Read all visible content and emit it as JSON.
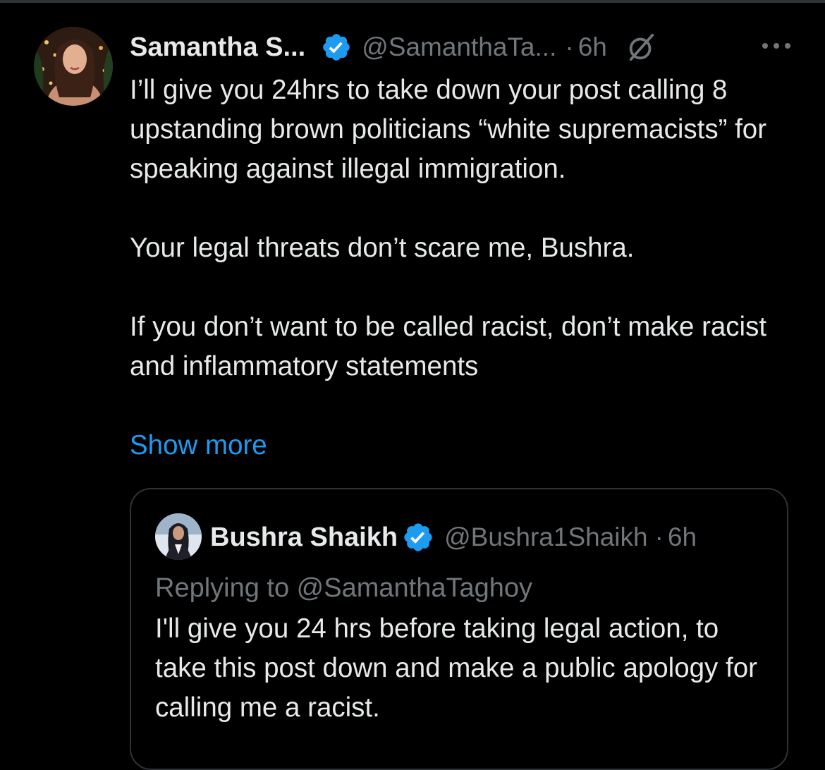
{
  "tweet": {
    "author_name": "Samantha S...",
    "author_handle": "@SamanthaTa...",
    "separator": "·",
    "time": "6h",
    "verified_icon": "verified-badge-icon",
    "grok_icon": "grok-icon",
    "more_icon": "more-icon",
    "paragraphs": [
      "I’ll give you 24hrs to take down your post calling 8 upstanding brown politicians “white supremacists” for speaking against illegal immigration.",
      "Your legal threats don’t scare me, Bushra.",
      "If you don’t want to be called racist, don’t make racist and inflammatory statements"
    ],
    "show_more": "Show more"
  },
  "quoted": {
    "author_name": "Bushra Shaikh",
    "author_handle": "@Bushra1Shaikh",
    "separator": "·",
    "time": "6h",
    "replying_to": "Replying to @SamanthaTaghoy",
    "text": "I'll give you 24 hrs before taking legal action, to take this post down and make a public apology for calling me a racist."
  },
  "colors": {
    "background": "#000000",
    "text_primary": "#e7e9ea",
    "text_secondary": "#71767b",
    "accent": "#1d9bf0",
    "border": "#2f3336"
  }
}
